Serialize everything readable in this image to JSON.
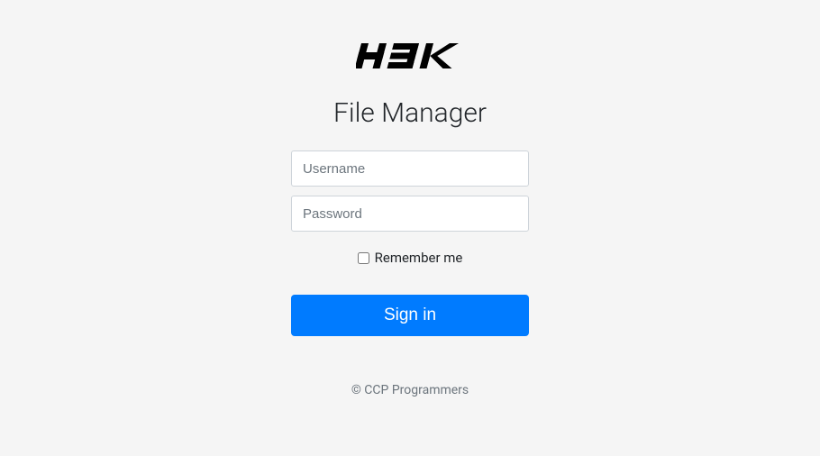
{
  "app": {
    "title": "File Manager"
  },
  "form": {
    "username_placeholder": "Username",
    "password_placeholder": "Password",
    "remember_label": "Remember me",
    "signin_label": "Sign in"
  },
  "footer": {
    "text": "© CCP Programmers"
  }
}
